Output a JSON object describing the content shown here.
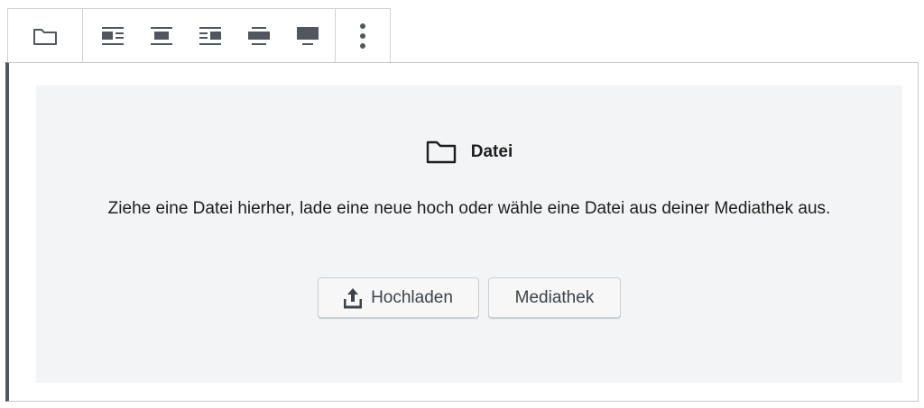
{
  "toolbar": {
    "block_type_icon": "folder-icon",
    "align_buttons": [
      {
        "name": "align-left-icon"
      },
      {
        "name": "align-center-icon"
      },
      {
        "name": "align-right-icon"
      },
      {
        "name": "align-wide-icon"
      },
      {
        "name": "align-full-icon"
      }
    ],
    "more_icon": "more-vertical-icon"
  },
  "placeholder": {
    "icon": "folder-icon",
    "label": "Datei",
    "instructions": "Ziehe eine Datei hierher, lade eine neue hoch oder wähle eine Datei aus deiner Mediathek aus.",
    "upload_icon": "upload-icon",
    "upload_label": "Hochladen",
    "library_label": "Mediathek"
  },
  "colors": {
    "block_border_accent": "#50575e",
    "placeholder_bg": "#f3f4f5",
    "button_bg": "#f7f7f7"
  }
}
